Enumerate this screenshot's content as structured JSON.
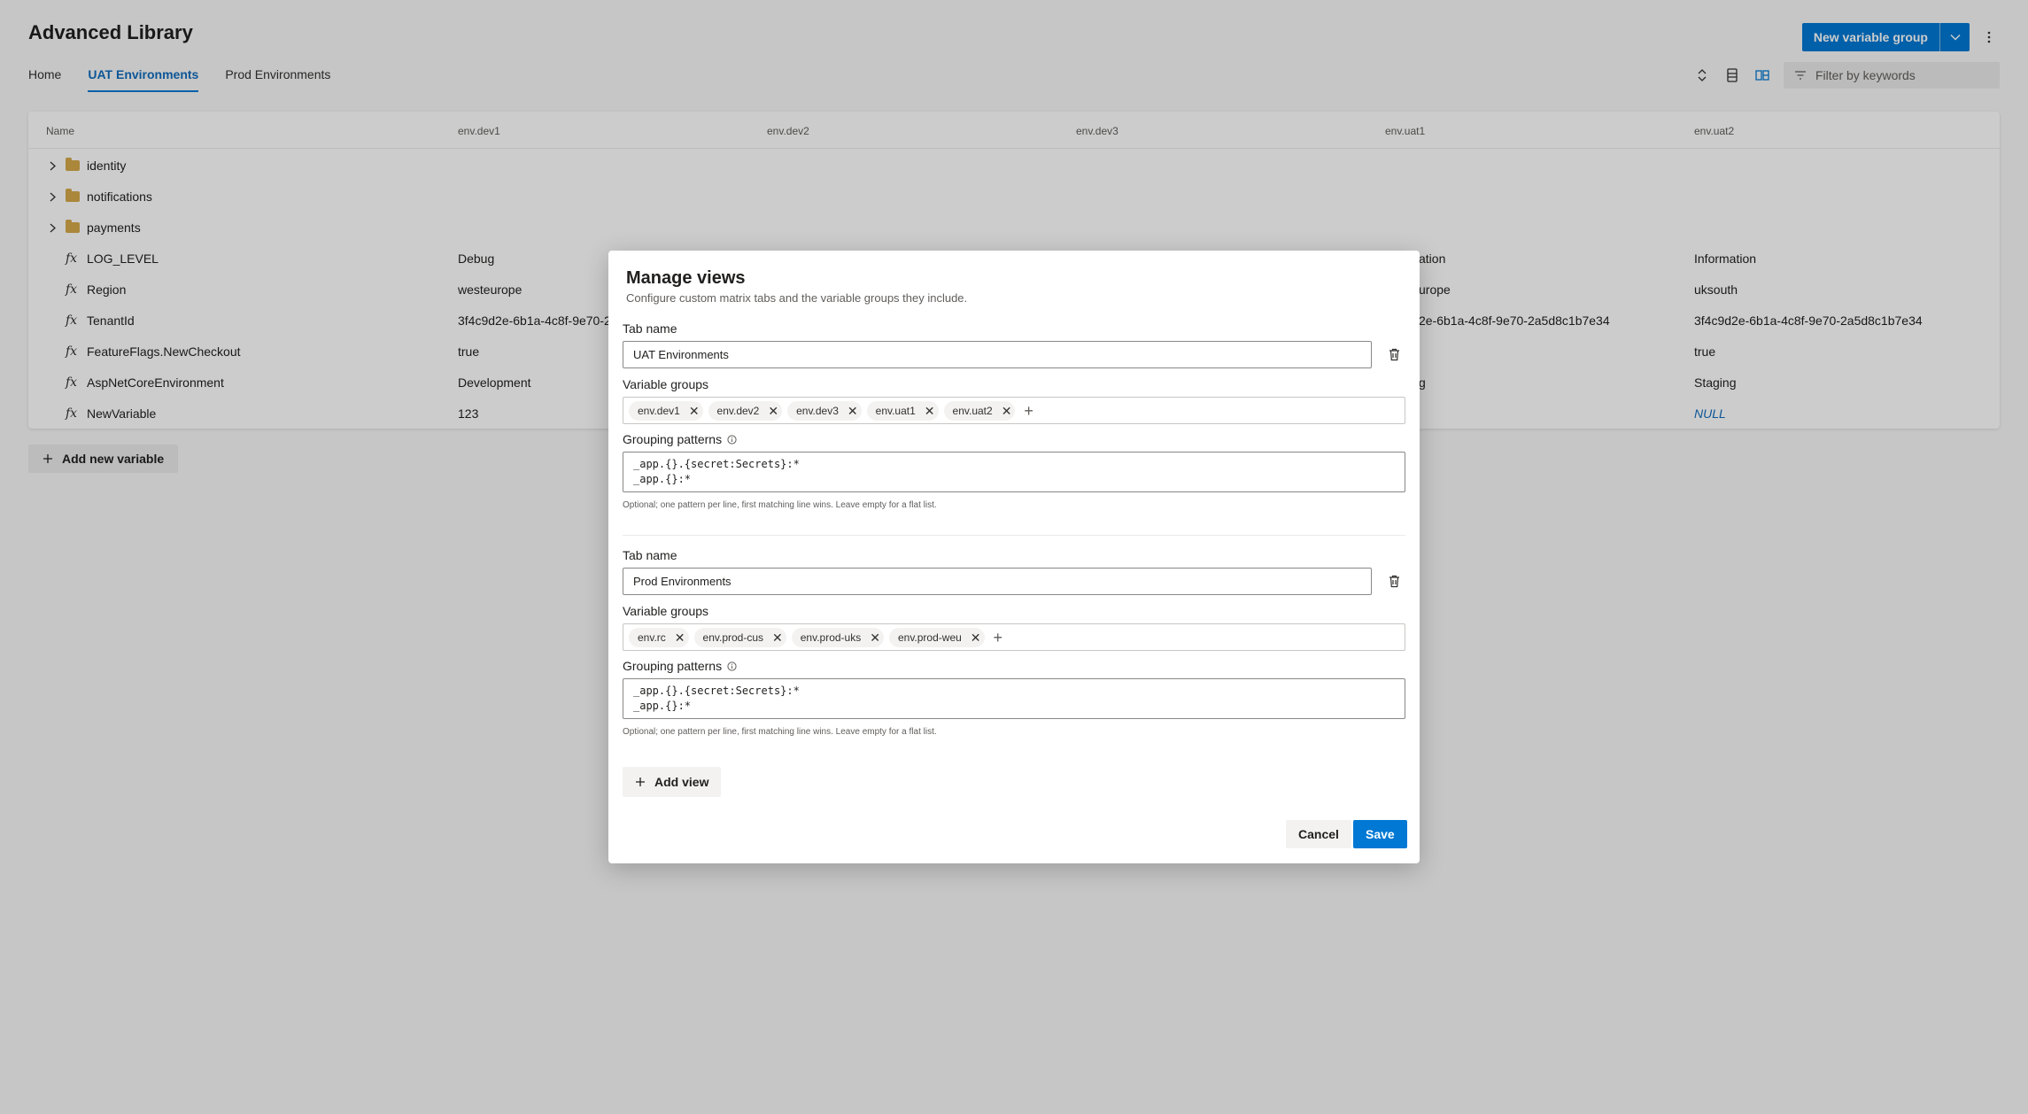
{
  "app": {
    "title": "Advanced Library"
  },
  "tabs": [
    {
      "label": "Home"
    },
    {
      "label": "UAT Environments",
      "active": true
    },
    {
      "label": "Prod Environments"
    }
  ],
  "header": {
    "new_group_label": "New variable group"
  },
  "icons": {
    "more": "more-vertical-icon",
    "expand_collapse": "expand-collapse-icon",
    "list_view": "list-view-icon",
    "matrix_view": "matrix-view-icon",
    "filter": "filter-icon",
    "chevron_right": "chevron-right-icon",
    "folder": "folder-icon",
    "fx": "fx-icon",
    "trash": "trash-icon",
    "info": "info-icon",
    "plus": "plus-icon"
  },
  "filter": {
    "placeholder": "Filter by keywords"
  },
  "grid": {
    "columns": [
      "Name",
      "env.dev1",
      "env.dev2",
      "env.dev3",
      "env.uat1",
      "env.uat2"
    ],
    "groups": [
      {
        "name": "identity"
      },
      {
        "name": "notifications"
      },
      {
        "name": "payments"
      }
    ],
    "variables": [
      {
        "name": "LOG_LEVEL",
        "dev1": "Debug",
        "uat1": "ation",
        "uat2": "Information"
      },
      {
        "name": "Region",
        "dev1": "westeurope",
        "uat1": "urope",
        "uat2": "uksouth"
      },
      {
        "name": "TenantId",
        "dev1": "3f4c9d2e-6b1a-4c8f-9e70-2",
        "uat1": "2e-6b1a-4c8f-9e70-2a5d8c1b7e34",
        "uat2": "3f4c9d2e-6b1a-4c8f-9e70-2a5d8c1b7e34"
      },
      {
        "name": "FeatureFlags.NewCheckout",
        "dev1": "true",
        "uat1": "",
        "uat2": "true"
      },
      {
        "name": "AspNetCoreEnvironment",
        "dev1": "Development",
        "uat1": "g",
        "uat2": "Staging"
      },
      {
        "name": "NewVariable",
        "dev1": "123",
        "uat1": "",
        "uat2": "NULL"
      }
    ]
  },
  "add_variable_label": "Add new variable",
  "dialog": {
    "title": "Manage views",
    "subtitle": "Configure custom matrix tabs and the variable groups they include.",
    "tab_name_label": "Tab name",
    "variable_groups_label": "Variable groups",
    "grouping_patterns_label": "Grouping patterns",
    "hint": "Optional; one pattern per line, first matching line wins. Leave empty for a flat list.",
    "views": [
      {
        "tab_name": "UAT Environments",
        "groups": [
          "env.dev1",
          "env.dev2",
          "env.dev3",
          "env.uat1",
          "env.uat2"
        ],
        "patterns": [
          "_app.{}.{secret:Secrets}:*",
          "_app.{}:*"
        ]
      },
      {
        "tab_name": "Prod Environments",
        "groups": [
          "env.rc",
          "env.prod-cus",
          "env.prod-uks",
          "env.prod-weu"
        ],
        "patterns": [
          "_app.{}.{secret:Secrets}:*",
          "_app.{}:*"
        ]
      }
    ],
    "add_view_label": "Add view",
    "cancel_label": "Cancel",
    "save_label": "Save"
  },
  "colors": {
    "accent": "#0078d4",
    "folder": "#d5a94a",
    "overlay": "rgba(0,0,0,0.2)"
  }
}
